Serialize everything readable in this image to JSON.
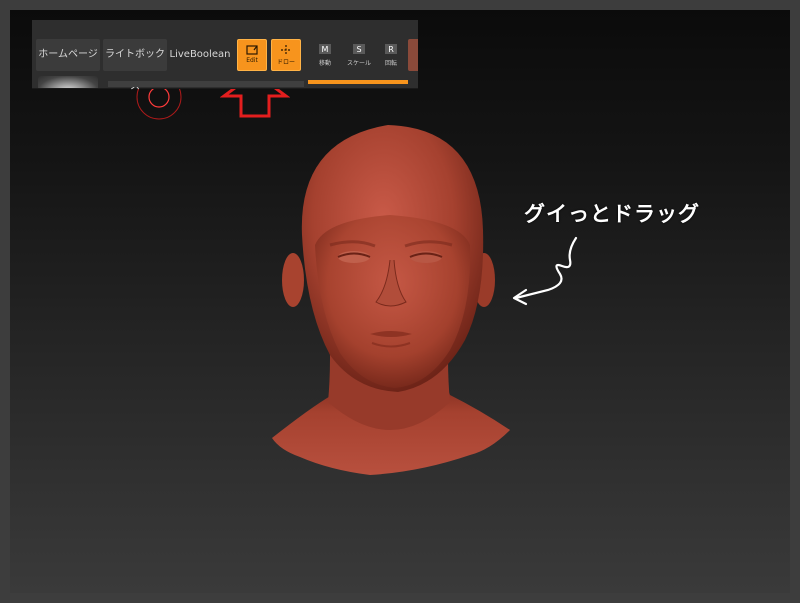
{
  "toolbar": {
    "home_label": "ホームページ",
    "lightbox_label": "ライトボックス",
    "liveboolean_label": "LiveBoolean",
    "edit_label": "Edit",
    "draw_label": "ドロー",
    "move_label": "移動",
    "scale_label": "スケール",
    "rotate_label": "回転",
    "move_key": "M",
    "scale_key": "S",
    "rotate_key": "R"
  },
  "annotation": {
    "text": "グイっとドラッグ"
  },
  "colors": {
    "accent_orange": "#f7941d",
    "arrow_red": "#e31e1e",
    "model_clay": "#b4483a"
  }
}
